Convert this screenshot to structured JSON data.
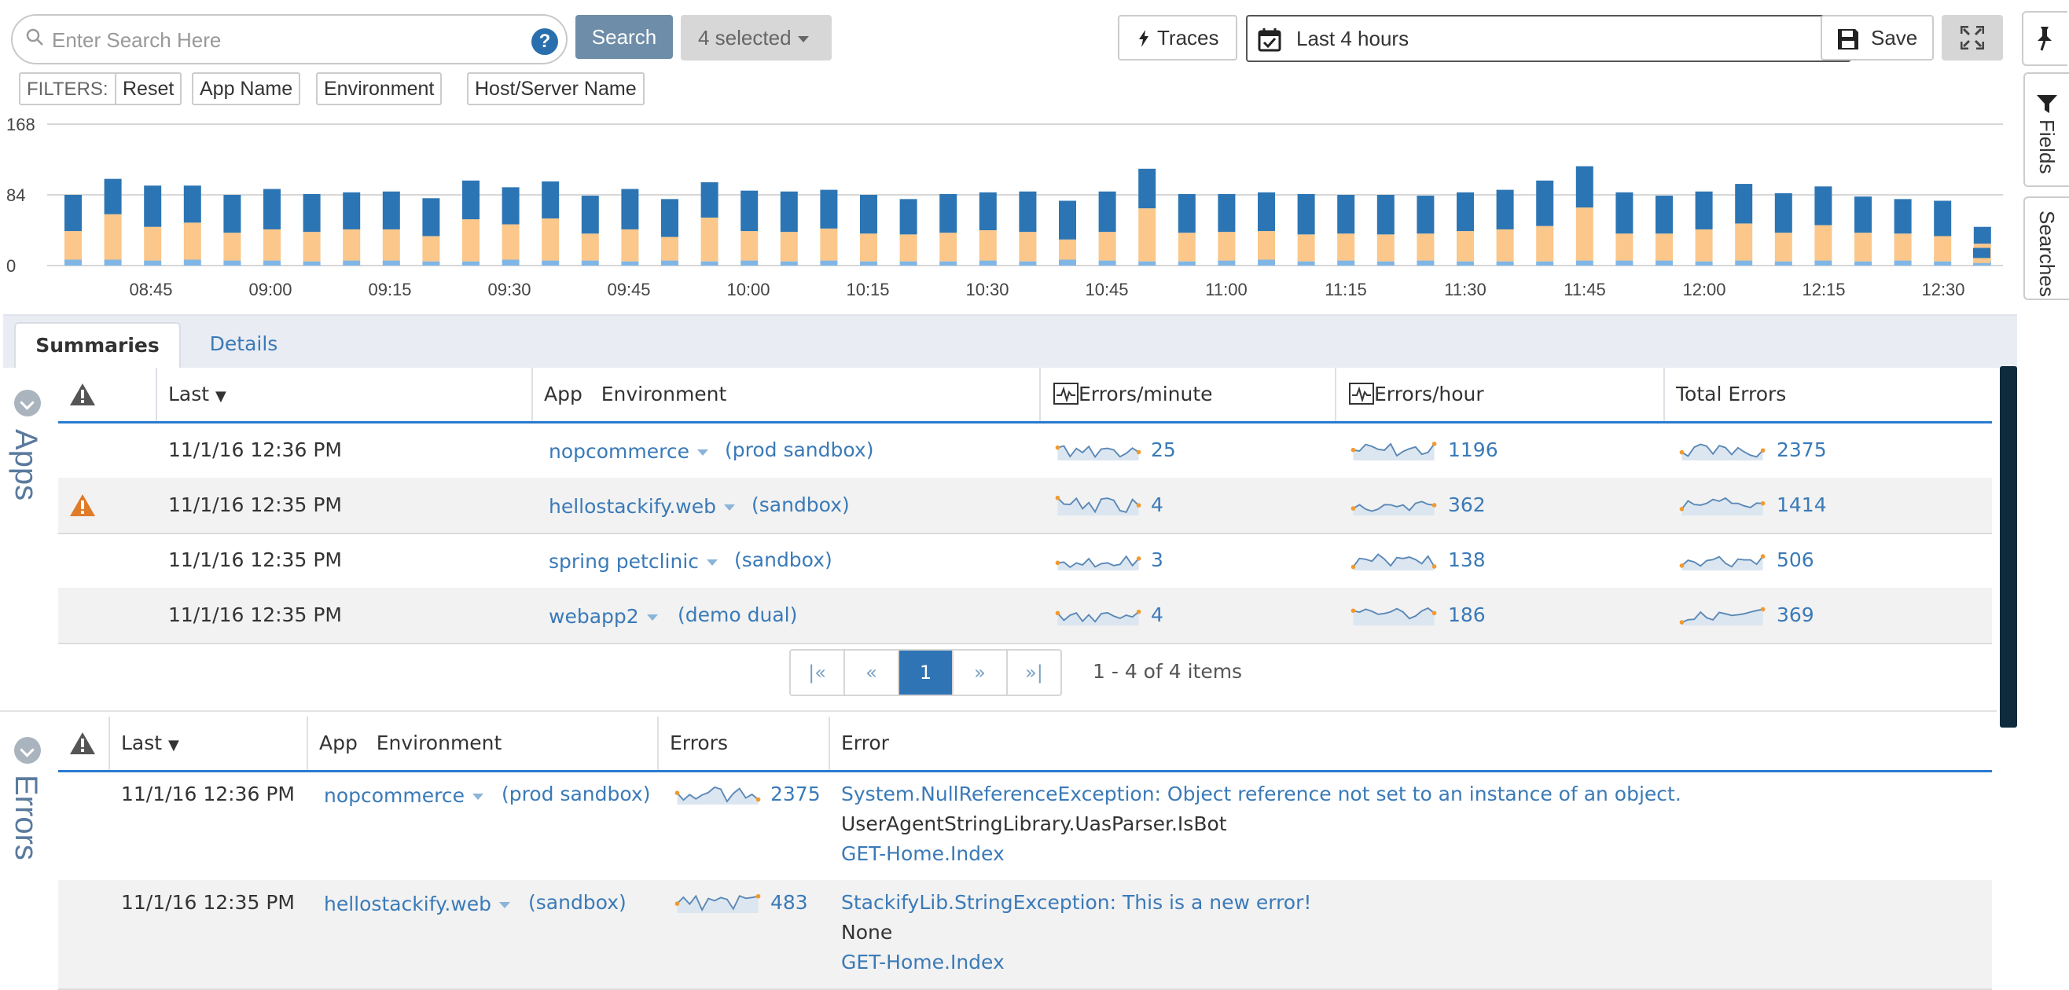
{
  "toolbar": {
    "search_placeholder": "Enter Search Here",
    "help_label": "?",
    "search_button": "Search",
    "selected_label": "4 selected",
    "traces_label": "Traces",
    "time_range": "Last 4 hours",
    "save_label": "Save"
  },
  "side_tabs": {
    "fields": "Fields",
    "searches": "Searches"
  },
  "filters": {
    "label": "FILTERS:",
    "reset": "Reset",
    "items": [
      "App Name",
      "Environment",
      "Host/Server Name"
    ]
  },
  "chart_data": {
    "type": "bar",
    "stacked": true,
    "y_ticks": [
      "168",
      "84",
      "0"
    ],
    "ylim": [
      0,
      168
    ],
    "x_ticks": [
      "08:45",
      "09:00",
      "09:15",
      "09:30",
      "09:45",
      "10:00",
      "10:15",
      "10:30",
      "10:45",
      "11:00",
      "11:15",
      "11:30",
      "11:45",
      "12:00",
      "12:15",
      "12:30"
    ],
    "colors": {
      "light": "#7fb6e6",
      "orange": "#fbc78a",
      "blue": "#2c75b4"
    },
    "series": [
      {
        "color": "light",
        "values": [
          7,
          7,
          6,
          7,
          6,
          6,
          5,
          6,
          6,
          5,
          5,
          7,
          6,
          6,
          5,
          6,
          5,
          6,
          5,
          6,
          5,
          5,
          5,
          6,
          5,
          7,
          6,
          5,
          5,
          6,
          7,
          5,
          6,
          5,
          6,
          5,
          5,
          5,
          6,
          6,
          6,
          5,
          6,
          5,
          6,
          5,
          6,
          5,
          6,
          4,
          5
        ]
      },
      {
        "color": "orange",
        "values": [
          34,
          54,
          40,
          44,
          33,
          37,
          35,
          37,
          37,
          30,
          50,
          42,
          50,
          32,
          38,
          28,
          52,
          35,
          35,
          38,
          33,
          32,
          34,
          36,
          35,
          24,
          34,
          63,
          34,
          34,
          34,
          32,
          32,
          32,
          32,
          36,
          38,
          42,
          63,
          32,
          32,
          38,
          44,
          34,
          42,
          34,
          32,
          30,
          20,
          3,
          4
        ]
      },
      {
        "color": "blue",
        "values": [
          43,
          42,
          49,
          44,
          45,
          48,
          45,
          44,
          45,
          45,
          46,
          44,
          44,
          45,
          48,
          45,
          42,
          48,
          48,
          46,
          46,
          42,
          46,
          45,
          48,
          46,
          48,
          47,
          46,
          45,
          46,
          48,
          46,
          47,
          45,
          46,
          47,
          54,
          49,
          49,
          45,
          45,
          47,
          47,
          46,
          43,
          41,
          42,
          20,
          0,
          0
        ]
      },
      {
        "color": "orange_top",
        "values": [
          0,
          0,
          0,
          0,
          0,
          0,
          0,
          0,
          0,
          0,
          0,
          0,
          0,
          0,
          0,
          0,
          0,
          0,
          0,
          0,
          0,
          0,
          0,
          0,
          0,
          0,
          0,
          0,
          0,
          0,
          0,
          0,
          0,
          0,
          0,
          0,
          0,
          0,
          0,
          0,
          0,
          0,
          0,
          0,
          0,
          0,
          0,
          0,
          0,
          0,
          0
        ]
      }
    ],
    "last_bar": {
      "light": 3,
      "orange": 6,
      "blue": 12
    }
  },
  "tabs": {
    "summaries": "Summaries",
    "details": "Details"
  },
  "apps": {
    "title": "Apps",
    "headers": {
      "last": "Last",
      "app": "App",
      "environment": "Environment",
      "epm": "Errors/minute",
      "eph": "Errors/hour",
      "total": "Total Errors"
    },
    "rows": [
      {
        "warn": false,
        "last": "11/1/16 12:36 PM",
        "app": "nopcommerce",
        "env": "(prod sandbox)",
        "epm": "25",
        "eph": "1196",
        "total": "2375"
      },
      {
        "warn": true,
        "last": "11/1/16 12:35 PM",
        "app": "hellostackify.web",
        "env": "(sandbox)",
        "epm": "4",
        "eph": "362",
        "total": "1414"
      },
      {
        "warn": false,
        "last": "11/1/16 12:35 PM",
        "app": "spring petclinic",
        "env": "(sandbox)",
        "epm": "3",
        "eph": "138",
        "total": "506"
      },
      {
        "warn": false,
        "last": "11/1/16 12:35 PM",
        "app": "webapp2",
        "env": "(demo dual)",
        "epm": "4",
        "eph": "186",
        "total": "369"
      }
    ],
    "pager": {
      "first": "|«",
      "prev": "«",
      "page": "1",
      "next": "»",
      "last": "»|",
      "info": "1 - 4 of 4 items"
    }
  },
  "errors": {
    "title": "Errors",
    "headers": {
      "last": "Last",
      "app": "App",
      "environment": "Environment",
      "errors": "Errors",
      "error": "Error"
    },
    "rows": [
      {
        "last": "11/1/16 12:36 PM",
        "app": "nopcommerce",
        "env": "(prod sandbox)",
        "count": "2375",
        "message": "System.NullReferenceException: Object reference not set to an instance of an object.",
        "source": "UserAgentStringLibrary.UasParser.IsBot",
        "route": "GET-Home.Index"
      },
      {
        "last": "11/1/16 12:35 PM",
        "app": "hellostackify.web",
        "env": "(sandbox)",
        "count": "483",
        "message": "StackifyLib.StringException: This is a new error!",
        "source": "None",
        "route": "GET-Home.Index"
      }
    ]
  }
}
